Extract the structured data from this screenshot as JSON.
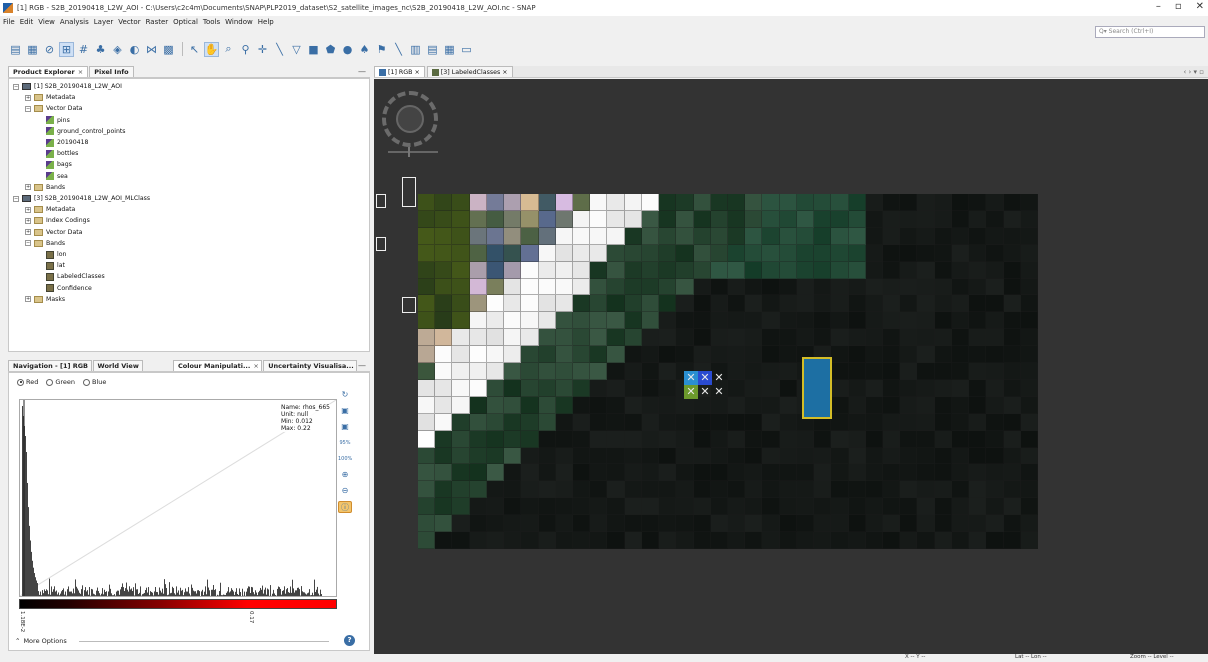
{
  "window": {
    "title": "[1] RGB - S2B_20190418_L2W_AOI - C:\\Users\\c2c4m\\Documents\\SNAP\\PLP2019_dataset\\S2_satellite_images_nc\\S2B_20190418_L2W_AOI.nc - SNAP",
    "minimize": "–",
    "maximize": "▫",
    "close": "✕"
  },
  "menu": [
    "File",
    "Edit",
    "View",
    "Analysis",
    "Layer",
    "Vector",
    "Raster",
    "Optical",
    "Tools",
    "Window",
    "Help"
  ],
  "search": {
    "placeholder": "Search (Ctrl+I)"
  },
  "explorer": {
    "tabs": [
      {
        "label": "Product Explorer",
        "close": "×"
      },
      {
        "label": "Pixel Info"
      }
    ],
    "minimize": "—",
    "nodes": [
      {
        "label": "[1] S2B_20190418_L2W_AOI",
        "level": 0,
        "icon": "product",
        "exp": "−"
      },
      {
        "label": "Metadata",
        "level": 1,
        "icon": "folder",
        "exp": "+"
      },
      {
        "label": "Vector Data",
        "level": 1,
        "icon": "folder",
        "exp": "−"
      },
      {
        "label": "pins",
        "level": 2,
        "icon": "vec"
      },
      {
        "label": "ground_control_points",
        "level": 2,
        "icon": "vec"
      },
      {
        "label": "20190418",
        "level": 2,
        "icon": "vec"
      },
      {
        "label": "bottles",
        "level": 2,
        "icon": "vec"
      },
      {
        "label": "bags",
        "level": 2,
        "icon": "vec"
      },
      {
        "label": "sea",
        "level": 2,
        "icon": "vec"
      },
      {
        "label": "Bands",
        "level": 1,
        "icon": "folder",
        "exp": "+"
      },
      {
        "label": "[3] S2B_20190418_L2W_AOI_MLClass",
        "level": 0,
        "icon": "product",
        "exp": "−"
      },
      {
        "label": "Metadata",
        "level": 1,
        "icon": "folder",
        "exp": "+"
      },
      {
        "label": "Index Codings",
        "level": 1,
        "icon": "folder",
        "exp": "+"
      },
      {
        "label": "Vector Data",
        "level": 1,
        "icon": "folder",
        "exp": "+"
      },
      {
        "label": "Bands",
        "level": 1,
        "icon": "folder",
        "exp": "−"
      },
      {
        "label": "lon",
        "level": 2,
        "icon": "band"
      },
      {
        "label": "lat",
        "level": 2,
        "icon": "band"
      },
      {
        "label": "LabeledClasses",
        "level": 2,
        "icon": "band"
      },
      {
        "label": "Confidence",
        "level": 2,
        "icon": "band"
      },
      {
        "label": "Masks",
        "level": 1,
        "icon": "folder",
        "exp": "+"
      }
    ]
  },
  "colour": {
    "tabs": [
      {
        "label": "Navigation - [1] RGB"
      },
      {
        "label": "World View"
      },
      {
        "label": "Colour Manipulati...",
        "close": "×"
      },
      {
        "label": "Uncertainty Visualisa..."
      }
    ],
    "minimize": "—",
    "radios": [
      {
        "label": "Red",
        "on": true
      },
      {
        "label": "Green",
        "on": false
      },
      {
        "label": "Blue",
        "on": false
      }
    ],
    "info": {
      "name": "Name: rhos_665",
      "unit": "Unit: null",
      "min": "Min: 0.012",
      "max": "Max: 0.22"
    },
    "tick_min": "1.18E-2",
    "tick_max": "0.17",
    "tick_max_frac": 0.72,
    "tools_pct_a": "95%",
    "tools_pct_b": "100%",
    "more_options": "More Options",
    "more_icon": "⌃",
    "help": "?"
  },
  "docs": {
    "tabs": [
      {
        "label": "[1] RGB",
        "close": "×",
        "icon": "b"
      },
      {
        "label": "[3] LabeledClasses",
        "close": "×",
        "icon": "g"
      }
    ],
    "nav": "‹ › ▾ ▫"
  },
  "status": {
    "x": "X -- Y --",
    "lat": "Lat -- Lon --",
    "zoom": "Zoom -- Level --"
  },
  "colors": {
    "accent": "#3a6ea5",
    "selection": "#1d6fa3",
    "selection_border": "#d4bd27",
    "canvas": "#333333"
  }
}
